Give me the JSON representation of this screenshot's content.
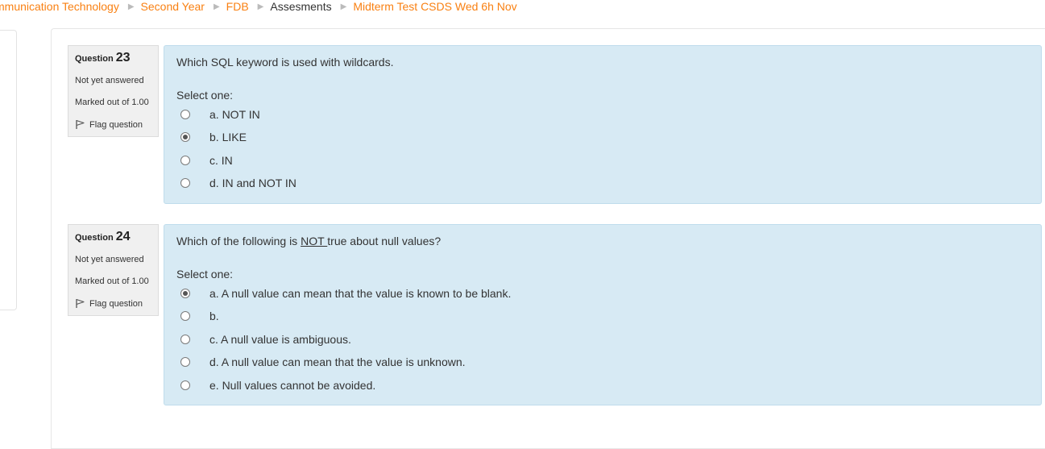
{
  "breadcrumb": {
    "items": [
      {
        "label": "mmunication Technology"
      },
      {
        "label": "Second Year"
      },
      {
        "label": "FDB"
      },
      {
        "label": "Assesments"
      },
      {
        "label": "Midterm Test CSDS Wed 6h Nov"
      }
    ]
  },
  "questions": [
    {
      "label": "Question",
      "number": "23",
      "state": "Not yet answered",
      "grade": "Marked out of 1.00",
      "flag_label": "Flag question",
      "text_before": "Which SQL keyword is used with wildcards.",
      "text_underlined": "",
      "text_after": "",
      "prompt": "Select one:",
      "answers": [
        {
          "label": "a. NOT IN",
          "selected": false
        },
        {
          "label": "b. LIKE",
          "selected": true
        },
        {
          "label": "c. IN",
          "selected": false
        },
        {
          "label": "d. IN and NOT IN",
          "selected": false
        }
      ]
    },
    {
      "label": "Question",
      "number": "24",
      "state": "Not yet answered",
      "grade": "Marked out of 1.00",
      "flag_label": "Flag question",
      "text_before": "Which of the following is ",
      "text_underlined": "NOT ",
      "text_after": "true about null values?",
      "prompt": "Select one:",
      "answers": [
        {
          "label": "a. A null value can mean that the value is known to be blank.",
          "selected": true
        },
        {
          "label": "b.",
          "selected": false
        },
        {
          "label": "c. A null value is ambiguous.",
          "selected": false
        },
        {
          "label": "d. A null value can mean that the value is unknown.",
          "selected": false
        },
        {
          "label": "e. Null values cannot be avoided.",
          "selected": false
        }
      ]
    }
  ],
  "icons": {
    "flag": "flag-icon",
    "separator": "triangle-right-icon"
  },
  "colors": {
    "link": "#f98012",
    "answer_bg": "#d7eaf4",
    "info_bg": "#f0f0f0"
  }
}
